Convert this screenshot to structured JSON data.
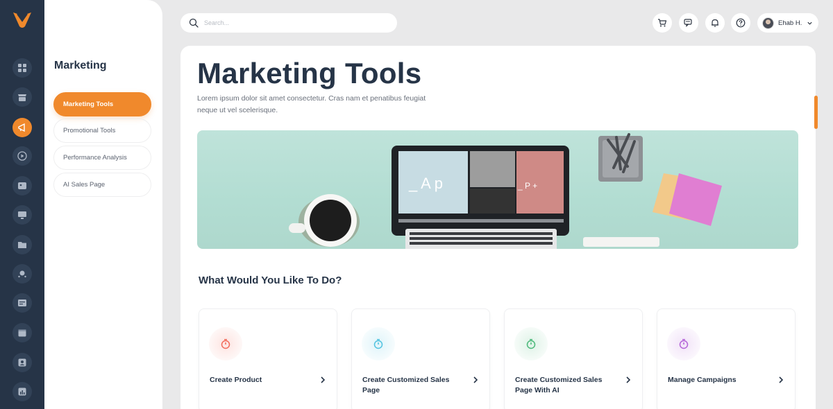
{
  "colors": {
    "accent": "#f0892c",
    "rail_bg": "#263447",
    "heading": "#263447",
    "banner_bg": "#b5ddd3",
    "card_red": "#f26b5b",
    "card_cyan": "#51c3e0",
    "card_green": "#4cb97a",
    "card_purple": "#b464d8"
  },
  "rail": {
    "icons": [
      "logo-icon",
      "dashboard-icon",
      "shop-icon",
      "marketing-icon",
      "play-icon",
      "media-icon",
      "monitor-icon",
      "folder-icon",
      "community-icon",
      "message-icon",
      "calendar-icon",
      "contacts-icon",
      "analytics-icon"
    ],
    "active": "marketing-icon"
  },
  "subnav": {
    "title": "Marketing",
    "items": [
      {
        "label": "Marketing Tools",
        "active": true
      },
      {
        "label": "Promotional Tools",
        "active": false
      },
      {
        "label": "Performance Analysis",
        "active": false
      },
      {
        "label": "AI Sales Page",
        "active": false
      }
    ]
  },
  "topbar": {
    "search_placeholder": "Search...",
    "icons": [
      "cart-icon",
      "chat-icon",
      "bell-icon",
      "help-icon"
    ],
    "user_name": "Ehab H."
  },
  "main": {
    "title": "Marketing Tools",
    "description": "Lorem ipsum dolor sit amet consectetur. Cras nam et penatibus feugiat neque ut vel scelerisque.",
    "banner_screen_text": [
      "_ A p",
      "_ P +"
    ],
    "section_title": "What Would You Like To Do?",
    "actions": [
      {
        "label": "Create Product",
        "color": "#f26b5b"
      },
      {
        "label": "Create Customized Sales Page",
        "color": "#51c3e0"
      },
      {
        "label": "Create Customized Sales Page With AI",
        "color": "#4cb97a"
      },
      {
        "label": "Manage Campaigns",
        "color": "#b464d8"
      }
    ]
  }
}
